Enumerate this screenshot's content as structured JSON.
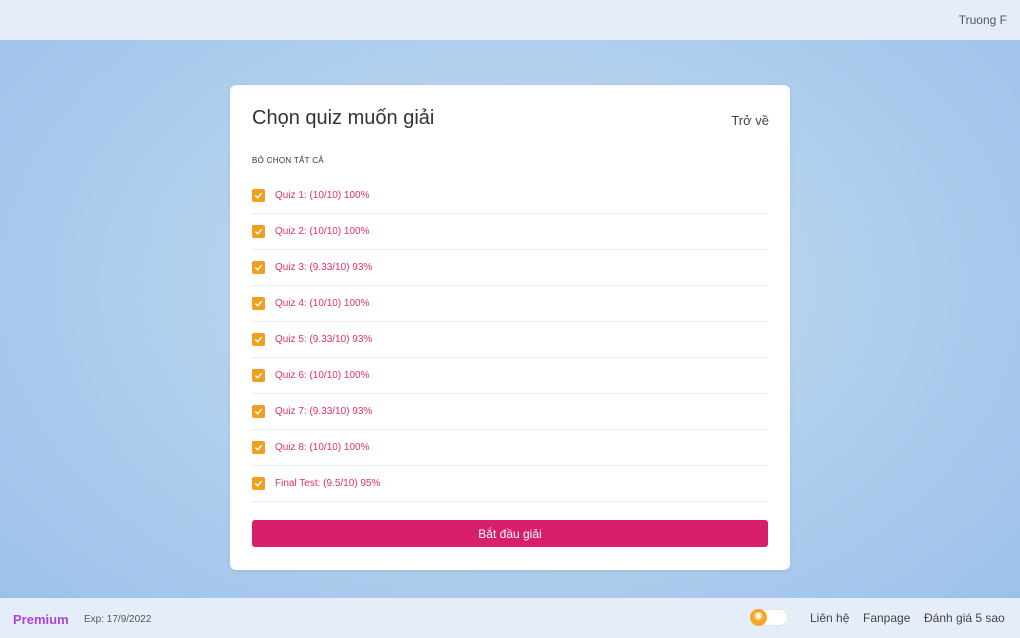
{
  "header": {
    "user_name": "Truong F"
  },
  "card": {
    "title": "Chọn quiz muốn giải",
    "back_label": "Trở về",
    "deselect_all_label": "Bỏ chọn tất cả",
    "quizzes": [
      {
        "label": "Quiz 1: (10/10) 100%",
        "checked": true
      },
      {
        "label": "Quiz 2: (10/10) 100%",
        "checked": true
      },
      {
        "label": "Quiz 3: (9.33/10) 93%",
        "checked": true
      },
      {
        "label": "Quiz 4: (10/10) 100%",
        "checked": true
      },
      {
        "label": "Quiz 5: (9.33/10) 93%",
        "checked": true
      },
      {
        "label": "Quiz 6: (10/10) 100%",
        "checked": true
      },
      {
        "label": "Quiz 7: (9.33/10) 93%",
        "checked": true
      },
      {
        "label": "Quiz 8: (10/10) 100%",
        "checked": true
      },
      {
        "label": "Final Test: (9.5/10) 95%",
        "checked": true
      }
    ],
    "start_button_label": "Bắt đầu giải"
  },
  "footer": {
    "premium_label": "Premium",
    "expiry": "Exp: 17/9/2022",
    "theme_toggle_icon": "sun-icon",
    "contact_label": "Liên hệ",
    "fanpage_label": "Fanpage",
    "rate_label": "Đánh giá 5 sao"
  },
  "colors": {
    "accent": "#d81f6e",
    "checkbox": "#f0a01e",
    "quiz_text": "#e0306e",
    "premium": "#a646e0"
  }
}
